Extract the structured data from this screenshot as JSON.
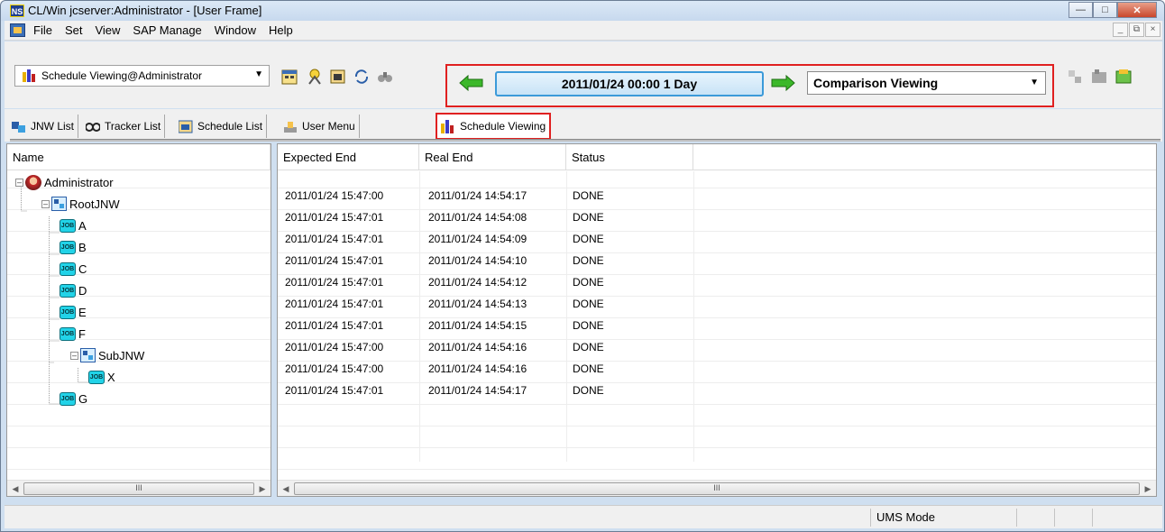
{
  "window": {
    "title": "CL/Win jcserver:Administrator - [User Frame]",
    "app_icon_text": "NS",
    "buttons": [
      "minimize",
      "maximize",
      "close"
    ]
  },
  "menubar": {
    "items": [
      "File",
      "Set",
      "View",
      "SAP Manage",
      "Window",
      "Help"
    ]
  },
  "toolbar": {
    "view_select": "Schedule Viewing@Administrator",
    "date_range": "2011/01/24 00:00   1 Day",
    "comparison_select": "Comparison Viewing"
  },
  "tabs": [
    {
      "label": "JNW List",
      "icon": "jnw-list-icon"
    },
    {
      "label": "Tracker List",
      "icon": "tracker-list-icon"
    },
    {
      "label": "Schedule List",
      "icon": "schedule-list-icon"
    },
    {
      "label": "User Menu",
      "icon": "user-menu-icon"
    },
    {
      "label": "Schedule Viewing",
      "icon": "schedule-viewing-icon",
      "active": true
    }
  ],
  "tree": {
    "header": "Name",
    "nodes": [
      {
        "label": "Administrator",
        "type": "user",
        "level": 0
      },
      {
        "label": "RootJNW",
        "type": "jnw",
        "level": 1
      },
      {
        "label": "A",
        "type": "job",
        "level": 2
      },
      {
        "label": "B",
        "type": "job",
        "level": 2
      },
      {
        "label": "C",
        "type": "job",
        "level": 2
      },
      {
        "label": "D",
        "type": "job",
        "level": 2
      },
      {
        "label": "E",
        "type": "job",
        "level": 2
      },
      {
        "label": "F",
        "type": "job",
        "level": 2
      },
      {
        "label": "SubJNW",
        "type": "jnw",
        "level": 2
      },
      {
        "label": "X",
        "type": "job",
        "level": 3
      },
      {
        "label": "G",
        "type": "job",
        "level": 2
      }
    ],
    "job_icon_text": "JOB"
  },
  "table": {
    "columns": [
      "Expected End",
      "Real End",
      "Status"
    ],
    "rows": [
      [
        "",
        "",
        ""
      ],
      [
        "2011/01/24 15:47:00",
        "2011/01/24 14:54:17",
        "DONE"
      ],
      [
        "2011/01/24 15:47:01",
        "2011/01/24 14:54:08",
        "DONE"
      ],
      [
        "2011/01/24 15:47:01",
        "2011/01/24 14:54:09",
        "DONE"
      ],
      [
        "2011/01/24 15:47:01",
        "2011/01/24 14:54:10",
        "DONE"
      ],
      [
        "2011/01/24 15:47:01",
        "2011/01/24 14:54:12",
        "DONE"
      ],
      [
        "2011/01/24 15:47:01",
        "2011/01/24 14:54:13",
        "DONE"
      ],
      [
        "2011/01/24 15:47:01",
        "2011/01/24 14:54:15",
        "DONE"
      ],
      [
        "2011/01/24 15:47:00",
        "2011/01/24 14:54:16",
        "DONE"
      ],
      [
        "2011/01/24 15:47:00",
        "2011/01/24 14:54:16",
        "DONE"
      ],
      [
        "2011/01/24 15:47:01",
        "2011/01/24 14:54:17",
        "DONE"
      ]
    ]
  },
  "scrollbars": {
    "thumb_grip": "III"
  },
  "statusbar": {
    "mode": "UMS Mode"
  },
  "colors": {
    "highlight_red": "#e02020",
    "job_cyan": "#22d3e8",
    "date_border_blue": "#3c9ad9",
    "arrow_green": "#3cb82a"
  }
}
